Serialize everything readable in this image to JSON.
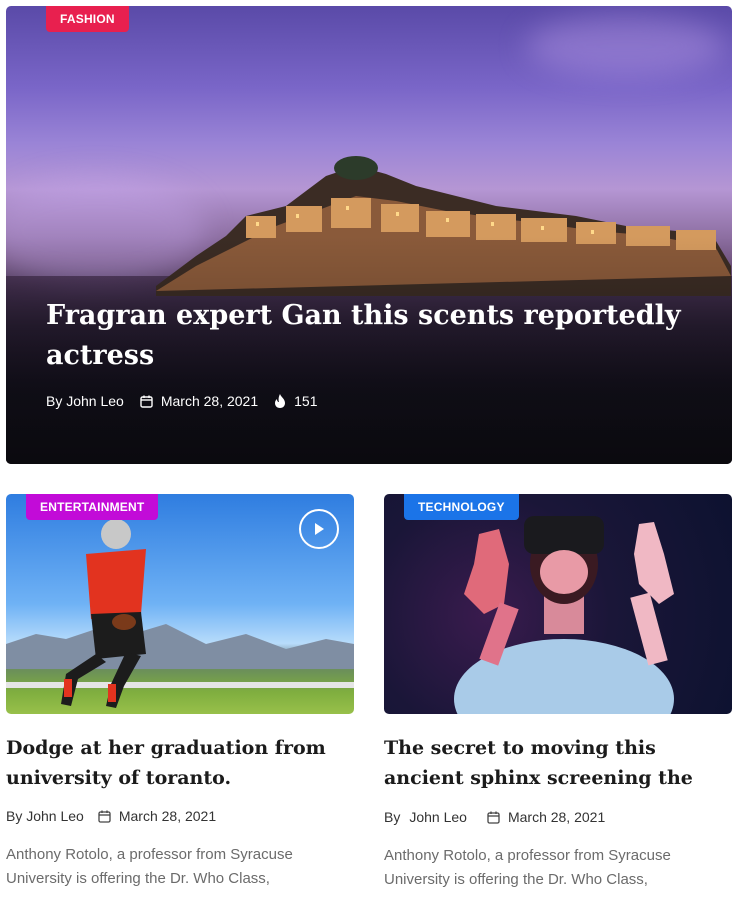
{
  "featured": {
    "category": "FASHION",
    "category_color": "#e8204f",
    "title": "Fragran expert Gan this scents reportedly actress",
    "author": "By John Leo",
    "date": "March 28, 2021",
    "views": "151",
    "date_icon": "calendar-icon",
    "views_icon": "fire-icon"
  },
  "cards": [
    {
      "category": "ENTERTAINMENT",
      "category_color": "#c20bd8",
      "title": "Dodge at her graduation from university of toranto.",
      "author": "By John Leo",
      "date": "March 28, 2021",
      "excerpt": "Anthony Rotolo, a professor from Syracuse University is offering the Dr. Who Class,",
      "has_video": true
    },
    {
      "category": "TECHNOLOGY",
      "category_color": "#1b74e8",
      "title": "The secret to moving this ancient sphinx screening the",
      "author_prefix": "By",
      "author_name": "John Leo",
      "date": "March 28, 2021",
      "excerpt": "Anthony Rotolo, a professor from Syracuse University is offering the Dr. Who Class,"
    }
  ]
}
